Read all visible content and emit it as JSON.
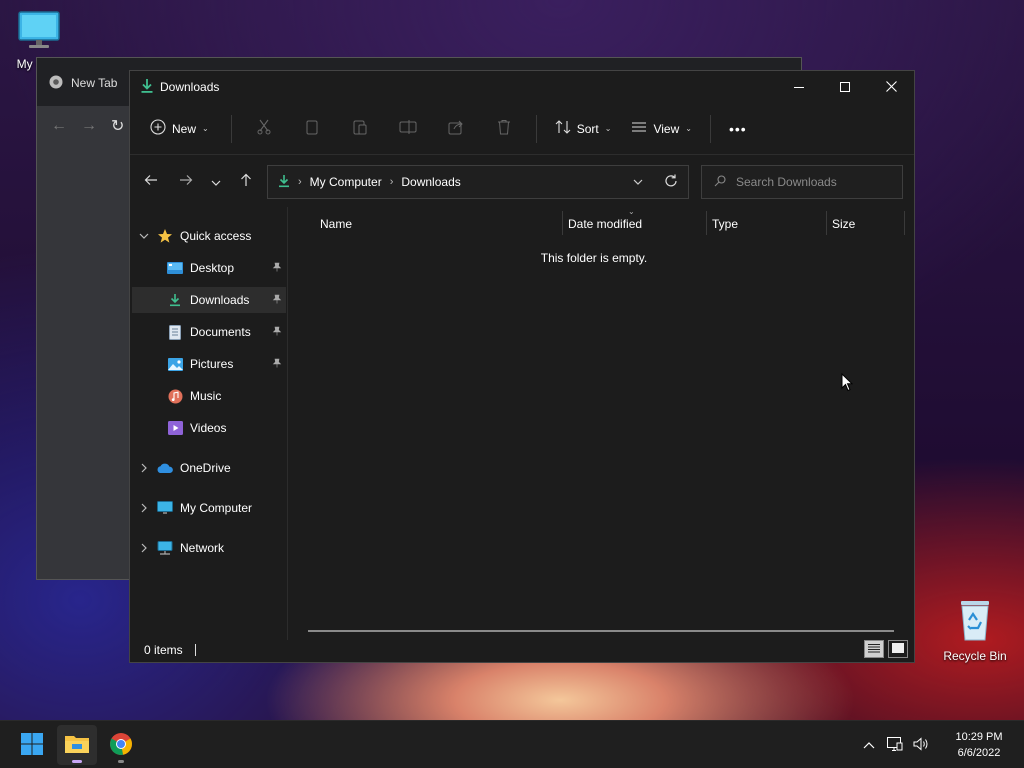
{
  "desktop": {
    "icons": [
      {
        "label": "My Co",
        "icon": "monitor-icon"
      },
      {
        "label": "Recycle Bin",
        "icon": "recycle-bin-icon"
      }
    ]
  },
  "chrome": {
    "tab_title": "New Tab"
  },
  "explorer": {
    "title": "Downloads",
    "window_controls": {
      "minimize": "minimize-icon",
      "maximize": "maximize-icon",
      "close": "close-icon"
    },
    "commandbar": {
      "new_label": "New",
      "sort_label": "Sort",
      "view_label": "View",
      "more_label": "•••"
    },
    "address": {
      "crumbs": [
        "My Computer",
        "Downloads"
      ],
      "search_placeholder": "Search Downloads"
    },
    "nav": {
      "quick_access": "Quick access",
      "items": [
        {
          "label": "Desktop",
          "icon": "desktop-folder-icon",
          "pinned": true
        },
        {
          "label": "Downloads",
          "icon": "downloads-folder-icon",
          "pinned": true,
          "selected": true
        },
        {
          "label": "Documents",
          "icon": "documents-folder-icon",
          "pinned": true
        },
        {
          "label": "Pictures",
          "icon": "pictures-folder-icon",
          "pinned": true
        },
        {
          "label": "Music",
          "icon": "music-folder-icon",
          "pinned": false
        },
        {
          "label": "Videos",
          "icon": "videos-folder-icon",
          "pinned": false
        }
      ],
      "onedrive": "OneDrive",
      "my_computer": "My Computer",
      "network": "Network"
    },
    "columns": [
      "Name",
      "Date modified",
      "Type",
      "Size"
    ],
    "empty_message": "This folder is empty.",
    "status": {
      "item_count": "0 items"
    }
  },
  "taskbar": {
    "time": "10:29 PM",
    "date": "6/6/2022"
  },
  "colors": {
    "accent_green": "#3fbf8f",
    "folder_yellow": "#f6c344",
    "explorer_bg": "#1c1c1c"
  }
}
